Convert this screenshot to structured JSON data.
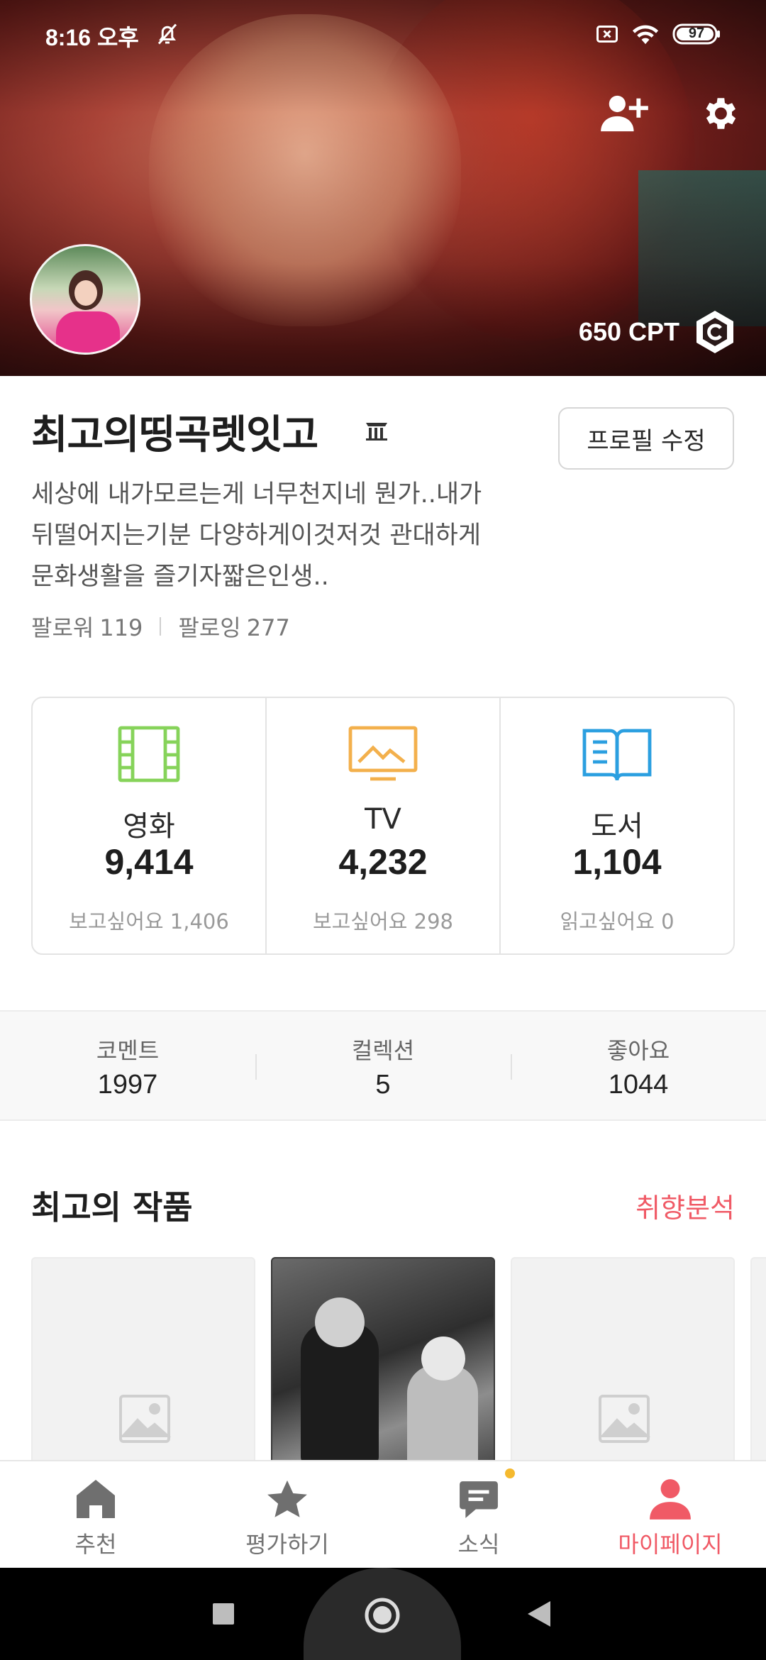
{
  "status_bar": {
    "time": "8:16 오후",
    "battery": "97"
  },
  "hero": {
    "points": "650 CPT",
    "icons": [
      "add-friend-icon",
      "gear-icon",
      "cpt-coin-icon"
    ]
  },
  "profile": {
    "name": "최고의띵곡렛잇고",
    "edit_button": "프로필 수정",
    "bio_lines": [
      "세상에 내가모르는게 너무천지네 뭔가..내가",
      "뒤떨어지는기분 다양하게이것저것 관대하게",
      "문화생활을 즐기자짧은인생.."
    ],
    "followers_label": "팔로워",
    "followers_count": "119",
    "following_label": "팔로잉",
    "following_count": "277"
  },
  "media": [
    {
      "label": "영화",
      "count": "9,414",
      "sub": "보고싶어요 1,406",
      "color": "#86d35a",
      "icon": "film-icon"
    },
    {
      "label": "TV",
      "count": "4,232",
      "sub": "보고싶어요 298",
      "color": "#f3b04c",
      "icon": "tv-icon"
    },
    {
      "label": "도서",
      "count": "1,104",
      "sub": "읽고싶어요 0",
      "color": "#2b9fe0",
      "icon": "book-icon"
    }
  ],
  "stats": [
    {
      "label": "코멘트",
      "value": "1997"
    },
    {
      "label": "컬렉션",
      "value": "5"
    },
    {
      "label": "좋아요",
      "value": "1044"
    }
  ],
  "best_works": {
    "title": "최고의 작품",
    "link": "취향분석"
  },
  "bottom_nav": [
    {
      "label": "추천",
      "icon": "home-icon"
    },
    {
      "label": "평가하기",
      "icon": "star-icon"
    },
    {
      "label": "소식",
      "icon": "chat-icon"
    },
    {
      "label": "마이페이지",
      "icon": "person-icon",
      "active": true
    }
  ],
  "colors": {
    "accent": "#f05a66",
    "notification_dot": "#f5b92e"
  }
}
